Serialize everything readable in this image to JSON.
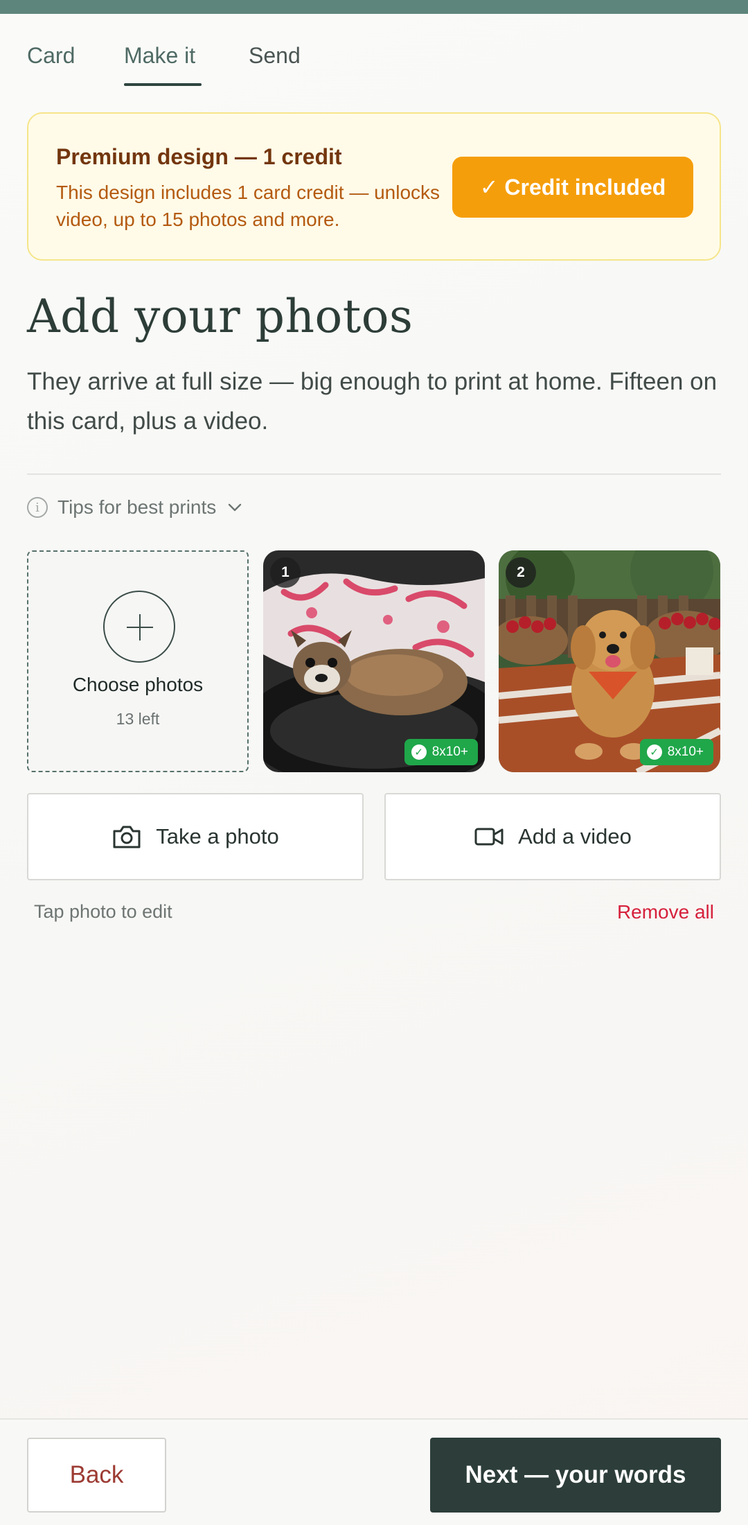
{
  "tabs": [
    {
      "label": "Card"
    },
    {
      "label": "Make it"
    },
    {
      "label": "Send"
    }
  ],
  "banner": {
    "title": "Premium design — 1 credit",
    "description": "This design includes 1 card credit — unlocks video, up to 15 photos and more.",
    "button_label": "✓ Credit included",
    "accent_color": "#f59e0b"
  },
  "page": {
    "title": "Add your photos",
    "subtitle": "They arrive at full size — big enough to print at home. Fifteen on this card, plus a video."
  },
  "tips": {
    "label": "Tips for best prints",
    "icon": "info-icon"
  },
  "uploader": {
    "choose_label": "Choose photos",
    "remaining": "13 left"
  },
  "photos": [
    {
      "number": "1",
      "quality": "8x10+",
      "subject": "dog-in-blanket"
    },
    {
      "number": "2",
      "quality": "8x10+",
      "subject": "golden-retriever-orchard"
    }
  ],
  "actions": {
    "take_photo": "Take a photo",
    "add_video": "Add a video"
  },
  "hint": "Tap photo to edit",
  "remove_all": "Remove all",
  "footer": {
    "back": "Back",
    "next": "Next — your words"
  },
  "colors": {
    "topbar": "#5e857b",
    "primary_dark": "#2d3e3a",
    "success_badge": "#1fa74a",
    "danger": "#d6213c"
  }
}
